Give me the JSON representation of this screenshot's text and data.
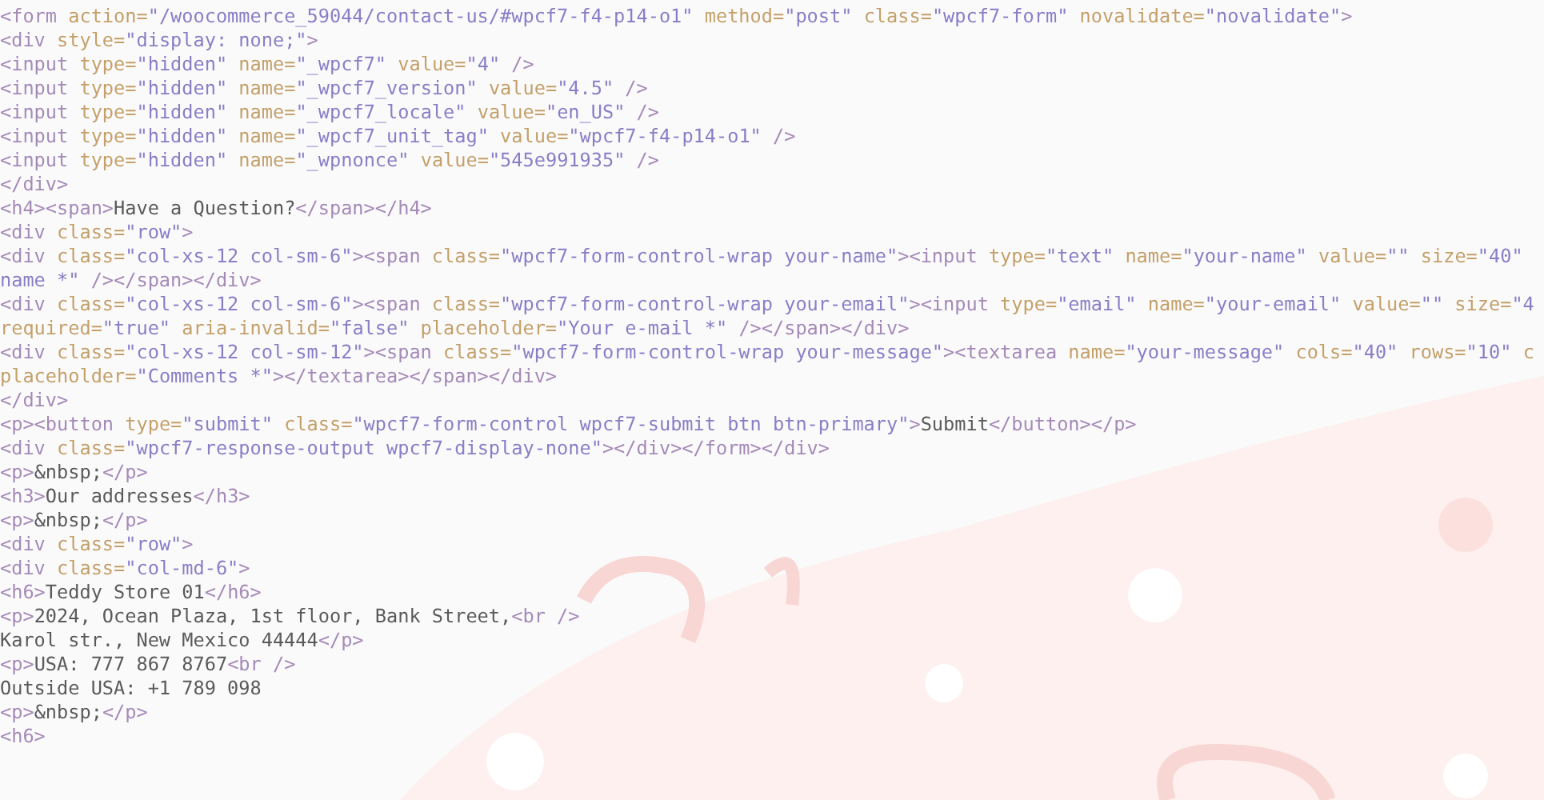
{
  "code_lines": [
    {
      "tokens": [
        {
          "kind": "tag",
          "text": "<form"
        },
        {
          "kind": "attr",
          "text": " action="
        },
        {
          "kind": "value",
          "text": "\"/woocommerce_59044/contact-us/#wpcf7-f4-p14-o1\""
        },
        {
          "kind": "attr",
          "text": " method="
        },
        {
          "kind": "value",
          "text": "\"post\""
        },
        {
          "kind": "attr",
          "text": " class="
        },
        {
          "kind": "value",
          "text": "\"wpcf7-form\""
        },
        {
          "kind": "attr",
          "text": " novalidate="
        },
        {
          "kind": "value",
          "text": "\"novalidate\""
        },
        {
          "kind": "tag",
          "text": ">"
        }
      ]
    },
    {
      "tokens": [
        {
          "kind": "tag",
          "text": "<div"
        },
        {
          "kind": "attr",
          "text": " style="
        },
        {
          "kind": "value",
          "text": "\"display: none;\""
        },
        {
          "kind": "tag",
          "text": ">"
        }
      ]
    },
    {
      "tokens": [
        {
          "kind": "tag",
          "text": "<input"
        },
        {
          "kind": "attr",
          "text": " type="
        },
        {
          "kind": "value",
          "text": "\"hidden\""
        },
        {
          "kind": "attr",
          "text": " name="
        },
        {
          "kind": "value",
          "text": "\"_wpcf7\""
        },
        {
          "kind": "attr",
          "text": " value="
        },
        {
          "kind": "value",
          "text": "\"4\""
        },
        {
          "kind": "tag",
          "text": " />"
        }
      ]
    },
    {
      "tokens": [
        {
          "kind": "tag",
          "text": "<input"
        },
        {
          "kind": "attr",
          "text": " type="
        },
        {
          "kind": "value",
          "text": "\"hidden\""
        },
        {
          "kind": "attr",
          "text": " name="
        },
        {
          "kind": "value",
          "text": "\"_wpcf7_version\""
        },
        {
          "kind": "attr",
          "text": " value="
        },
        {
          "kind": "value",
          "text": "\"4.5\""
        },
        {
          "kind": "tag",
          "text": " />"
        }
      ]
    },
    {
      "tokens": [
        {
          "kind": "tag",
          "text": "<input"
        },
        {
          "kind": "attr",
          "text": " type="
        },
        {
          "kind": "value",
          "text": "\"hidden\""
        },
        {
          "kind": "attr",
          "text": " name="
        },
        {
          "kind": "value",
          "text": "\"_wpcf7_locale\""
        },
        {
          "kind": "attr",
          "text": " value="
        },
        {
          "kind": "value",
          "text": "\"en_US\""
        },
        {
          "kind": "tag",
          "text": " />"
        }
      ]
    },
    {
      "tokens": [
        {
          "kind": "tag",
          "text": "<input"
        },
        {
          "kind": "attr",
          "text": " type="
        },
        {
          "kind": "value",
          "text": "\"hidden\""
        },
        {
          "kind": "attr",
          "text": " name="
        },
        {
          "kind": "value",
          "text": "\"_wpcf7_unit_tag\""
        },
        {
          "kind": "attr",
          "text": " value="
        },
        {
          "kind": "value",
          "text": "\"wpcf7-f4-p14-o1\""
        },
        {
          "kind": "tag",
          "text": " />"
        }
      ]
    },
    {
      "tokens": [
        {
          "kind": "tag",
          "text": "<input"
        },
        {
          "kind": "attr",
          "text": " type="
        },
        {
          "kind": "value",
          "text": "\"hidden\""
        },
        {
          "kind": "attr",
          "text": " name="
        },
        {
          "kind": "value",
          "text": "\"_wpnonce\""
        },
        {
          "kind": "attr",
          "text": " value="
        },
        {
          "kind": "value",
          "text": "\"545e991935\""
        },
        {
          "kind": "tag",
          "text": " />"
        }
      ]
    },
    {
      "tokens": [
        {
          "kind": "tag",
          "text": "</div>"
        }
      ]
    },
    {
      "tokens": [
        {
          "kind": "tag",
          "text": "<h4><span>"
        },
        {
          "kind": "text",
          "text": "Have a Question?"
        },
        {
          "kind": "tag",
          "text": "</span></h4>"
        }
      ]
    },
    {
      "tokens": [
        {
          "kind": "tag",
          "text": "<div"
        },
        {
          "kind": "attr",
          "text": " class="
        },
        {
          "kind": "value",
          "text": "\"row\""
        },
        {
          "kind": "tag",
          "text": ">"
        }
      ]
    },
    {
      "tokens": [
        {
          "kind": "tag",
          "text": "<div"
        },
        {
          "kind": "attr",
          "text": " class="
        },
        {
          "kind": "value",
          "text": "\"col-xs-12 col-sm-6\""
        },
        {
          "kind": "tag",
          "text": "><span"
        },
        {
          "kind": "attr",
          "text": " class="
        },
        {
          "kind": "value",
          "text": "\"wpcf7-form-control-wrap your-name\""
        },
        {
          "kind": "tag",
          "text": "><input"
        },
        {
          "kind": "attr",
          "text": " type="
        },
        {
          "kind": "value",
          "text": "\"text\""
        },
        {
          "kind": "attr",
          "text": " name="
        },
        {
          "kind": "value",
          "text": "\"your-name\""
        },
        {
          "kind": "attr",
          "text": " value="
        },
        {
          "kind": "value",
          "text": "\"\""
        },
        {
          "kind": "attr",
          "text": " size="
        },
        {
          "kind": "value",
          "text": "\"40\""
        }
      ]
    },
    {
      "tokens": [
        {
          "kind": "value",
          "text": "name *\""
        },
        {
          "kind": "tag",
          "text": " /></span></div>"
        }
      ]
    },
    {
      "tokens": [
        {
          "kind": "tag",
          "text": "<div"
        },
        {
          "kind": "attr",
          "text": " class="
        },
        {
          "kind": "value",
          "text": "\"col-xs-12 col-sm-6\""
        },
        {
          "kind": "tag",
          "text": "><span"
        },
        {
          "kind": "attr",
          "text": " class="
        },
        {
          "kind": "value",
          "text": "\"wpcf7-form-control-wrap your-email\""
        },
        {
          "kind": "tag",
          "text": "><input"
        },
        {
          "kind": "attr",
          "text": " type="
        },
        {
          "kind": "value",
          "text": "\"email\""
        },
        {
          "kind": "attr",
          "text": " name="
        },
        {
          "kind": "value",
          "text": "\"your-email\""
        },
        {
          "kind": "attr",
          "text": " value="
        },
        {
          "kind": "value",
          "text": "\"\""
        },
        {
          "kind": "attr",
          "text": " size="
        },
        {
          "kind": "value",
          "text": "\"4"
        }
      ]
    },
    {
      "tokens": [
        {
          "kind": "attr",
          "text": "required="
        },
        {
          "kind": "value",
          "text": "\"true\""
        },
        {
          "kind": "attr",
          "text": " aria-invalid="
        },
        {
          "kind": "value",
          "text": "\"false\""
        },
        {
          "kind": "attr",
          "text": " placeholder="
        },
        {
          "kind": "value",
          "text": "\"Your e-mail *\""
        },
        {
          "kind": "tag",
          "text": " /></span></div>"
        }
      ]
    },
    {
      "tokens": [
        {
          "kind": "tag",
          "text": "<div"
        },
        {
          "kind": "attr",
          "text": " class="
        },
        {
          "kind": "value",
          "text": "\"col-xs-12 col-sm-12\""
        },
        {
          "kind": "tag",
          "text": "><span"
        },
        {
          "kind": "attr",
          "text": " class="
        },
        {
          "kind": "value",
          "text": "\"wpcf7-form-control-wrap your-message\""
        },
        {
          "kind": "tag",
          "text": "><textarea"
        },
        {
          "kind": "attr",
          "text": " name="
        },
        {
          "kind": "value",
          "text": "\"your-message\""
        },
        {
          "kind": "attr",
          "text": " cols="
        },
        {
          "kind": "value",
          "text": "\"40\""
        },
        {
          "kind": "attr",
          "text": " rows="
        },
        {
          "kind": "value",
          "text": "\"10\""
        },
        {
          "kind": "attr",
          "text": " c"
        }
      ]
    },
    {
      "tokens": [
        {
          "kind": "attr",
          "text": "placeholder="
        },
        {
          "kind": "value",
          "text": "\"Comments *\""
        },
        {
          "kind": "tag",
          "text": "></textarea></span></div>"
        }
      ]
    },
    {
      "tokens": [
        {
          "kind": "tag",
          "text": "</div>"
        }
      ]
    },
    {
      "tokens": [
        {
          "kind": "tag",
          "text": "<p><button"
        },
        {
          "kind": "attr",
          "text": " type="
        },
        {
          "kind": "value",
          "text": "\"submit\""
        },
        {
          "kind": "attr",
          "text": " class="
        },
        {
          "kind": "value",
          "text": "\"wpcf7-form-control wpcf7-submit btn btn-primary\""
        },
        {
          "kind": "tag",
          "text": ">"
        },
        {
          "kind": "text",
          "text": "Submit"
        },
        {
          "kind": "tag",
          "text": "</button></p>"
        }
      ]
    },
    {
      "tokens": [
        {
          "kind": "tag",
          "text": "<div"
        },
        {
          "kind": "attr",
          "text": " class="
        },
        {
          "kind": "value",
          "text": "\"wpcf7-response-output wpcf7-display-none\""
        },
        {
          "kind": "tag",
          "text": "></div></form></div>"
        }
      ]
    },
    {
      "tokens": [
        {
          "kind": "tag",
          "text": "<p>"
        },
        {
          "kind": "text",
          "text": "&nbsp;"
        },
        {
          "kind": "tag",
          "text": "</p>"
        }
      ]
    },
    {
      "tokens": [
        {
          "kind": "tag",
          "text": "<h3>"
        },
        {
          "kind": "text",
          "text": "Our addresses"
        },
        {
          "kind": "tag",
          "text": "</h3>"
        }
      ]
    },
    {
      "tokens": [
        {
          "kind": "tag",
          "text": "<p>"
        },
        {
          "kind": "text",
          "text": "&nbsp;"
        },
        {
          "kind": "tag",
          "text": "</p>"
        }
      ]
    },
    {
      "tokens": [
        {
          "kind": "tag",
          "text": "<div"
        },
        {
          "kind": "attr",
          "text": " class="
        },
        {
          "kind": "value",
          "text": "\"row\""
        },
        {
          "kind": "tag",
          "text": ">"
        }
      ]
    },
    {
      "tokens": [
        {
          "kind": "tag",
          "text": "<div"
        },
        {
          "kind": "attr",
          "text": " class="
        },
        {
          "kind": "value",
          "text": "\"col-md-6\""
        },
        {
          "kind": "tag",
          "text": ">"
        }
      ]
    },
    {
      "tokens": [
        {
          "kind": "tag",
          "text": "<h6>"
        },
        {
          "kind": "text",
          "text": "Teddy Store 01"
        },
        {
          "kind": "tag",
          "text": "</h6>"
        }
      ]
    },
    {
      "tokens": [
        {
          "kind": "tag",
          "text": "<p>"
        },
        {
          "kind": "text",
          "text": "2024, Ocean Plaza, 1st floor, Bank Street,"
        },
        {
          "kind": "tag",
          "text": "<br />"
        }
      ]
    },
    {
      "tokens": [
        {
          "kind": "text",
          "text": "Karol str., New Mexico 44444"
        },
        {
          "kind": "tag",
          "text": "</p>"
        }
      ]
    },
    {
      "tokens": [
        {
          "kind": "tag",
          "text": "<p>"
        },
        {
          "kind": "text",
          "text": "USA: 777 867 8767"
        },
        {
          "kind": "tag",
          "text": "<br />"
        }
      ]
    },
    {
      "tokens": [
        {
          "kind": "text",
          "text": "Outside USA: +1 789 098"
        }
      ]
    },
    {
      "tokens": [
        {
          "kind": "tag",
          "text": "<p>"
        },
        {
          "kind": "text",
          "text": "&nbsp;"
        },
        {
          "kind": "tag",
          "text": "</p>"
        }
      ]
    },
    {
      "tokens": [
        {
          "kind": "tag",
          "text": "<h6>"
        }
      ]
    }
  ]
}
